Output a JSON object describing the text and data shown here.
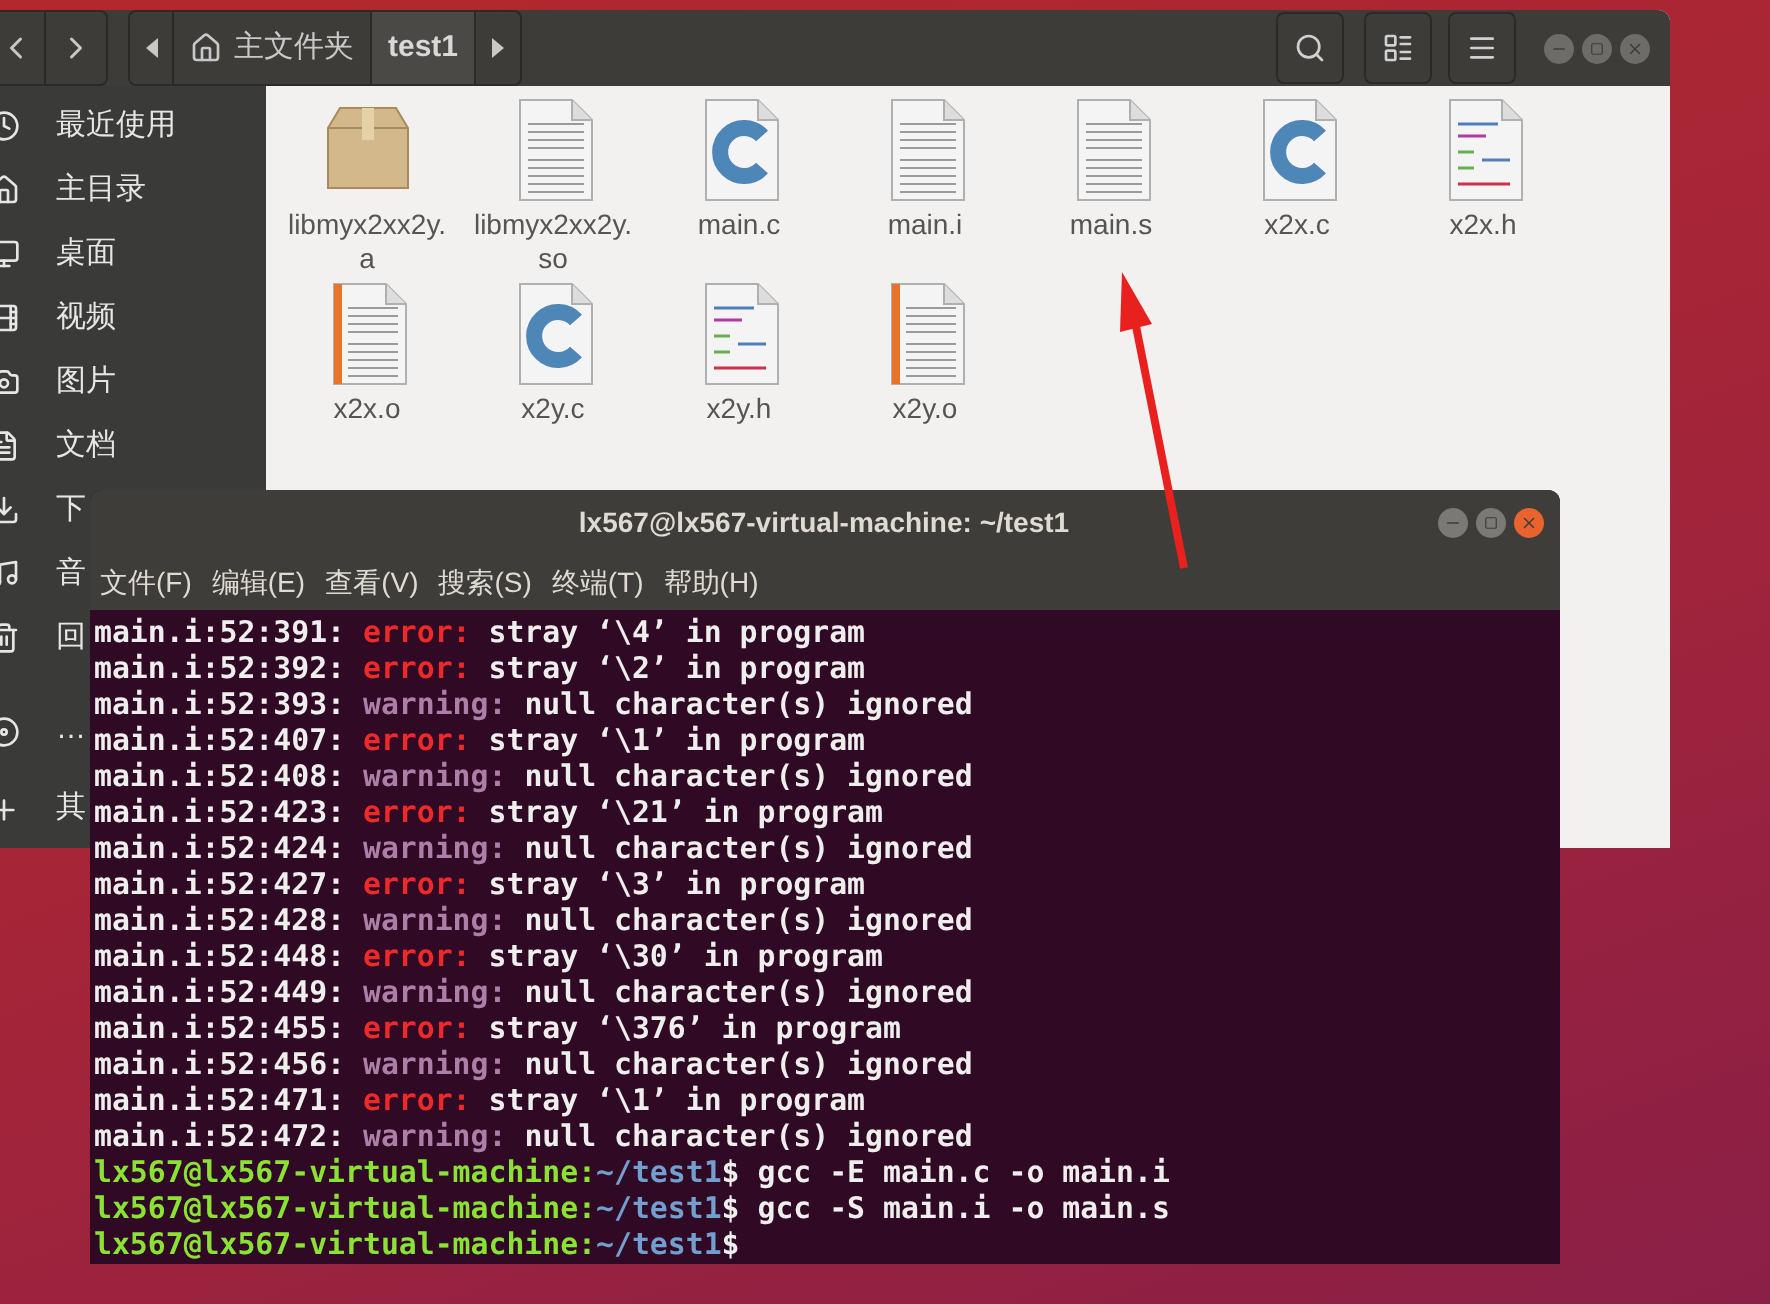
{
  "file_manager": {
    "path_bar": [
      {
        "label": "主文件夹",
        "kind": "home",
        "selected": false
      },
      {
        "label": "test1",
        "kind": "folder",
        "selected": true
      }
    ],
    "sidebar": {
      "sections": [
        [
          {
            "label": "最近使用",
            "kind": "recent"
          },
          {
            "label": "主目录",
            "kind": "home"
          },
          {
            "label": "桌面",
            "kind": "desktop"
          },
          {
            "label": "视频",
            "kind": "video"
          },
          {
            "label": "图片",
            "kind": "picture"
          },
          {
            "label": "文档",
            "kind": "document"
          },
          {
            "label": "下",
            "kind": "download"
          },
          {
            "label": "音",
            "kind": "music"
          },
          {
            "label": "回",
            "kind": "trash"
          }
        ],
        [
          {
            "label": "…",
            "kind": "disc"
          },
          {
            "label": "其",
            "kind": "other"
          }
        ]
      ]
    },
    "files": [
      {
        "name": "libmyx2xx2y.a",
        "kind": "archive"
      },
      {
        "name": "libmyx2xx2y.so",
        "kind": "text"
      },
      {
        "name": "main.c",
        "kind": "c"
      },
      {
        "name": "main.i",
        "kind": "text"
      },
      {
        "name": "main.s",
        "kind": "text"
      },
      {
        "name": "x2x.c",
        "kind": "c"
      },
      {
        "name": "x2x.h",
        "kind": "header"
      },
      {
        "name": "x2x.o",
        "kind": "object"
      },
      {
        "name": "x2y.c",
        "kind": "c"
      },
      {
        "name": "x2y.h",
        "kind": "header"
      },
      {
        "name": "x2y.o",
        "kind": "object"
      }
    ]
  },
  "terminal": {
    "title": "lx567@lx567-virtual-machine: ~/test1",
    "menu": [
      "文件(F)",
      "编辑(E)",
      "查看(V)",
      "搜索(S)",
      "终端(T)",
      "帮助(H)"
    ],
    "lines": [
      {
        "kind": "error",
        "location": "main.i:52:391:",
        "label": "error:",
        "message": "stray ‘\\4’ in program"
      },
      {
        "kind": "error",
        "location": "main.i:52:392:",
        "label": "error:",
        "message": "stray ‘\\2’ in program"
      },
      {
        "kind": "warning",
        "location": "main.i:52:393:",
        "label": "warning:",
        "message": "null character(s) ignored"
      },
      {
        "kind": "error",
        "location": "main.i:52:407:",
        "label": "error:",
        "message": "stray ‘\\1’ in program"
      },
      {
        "kind": "warning",
        "location": "main.i:52:408:",
        "label": "warning:",
        "message": "null character(s) ignored"
      },
      {
        "kind": "error",
        "location": "main.i:52:423:",
        "label": "error:",
        "message": "stray ‘\\21’ in program"
      },
      {
        "kind": "warning",
        "location": "main.i:52:424:",
        "label": "warning:",
        "message": "null character(s) ignored"
      },
      {
        "kind": "error",
        "location": "main.i:52:427:",
        "label": "error:",
        "message": "stray ‘\\3’ in program"
      },
      {
        "kind": "warning",
        "location": "main.i:52:428:",
        "label": "warning:",
        "message": "null character(s) ignored"
      },
      {
        "kind": "error",
        "location": "main.i:52:448:",
        "label": "error:",
        "message": "stray ‘\\30’ in program"
      },
      {
        "kind": "warning",
        "location": "main.i:52:449:",
        "label": "warning:",
        "message": "null character(s) ignored"
      },
      {
        "kind": "error",
        "location": "main.i:52:455:",
        "label": "error:",
        "message": "stray ‘\\376’ in program"
      },
      {
        "kind": "warning",
        "location": "main.i:52:456:",
        "label": "warning:",
        "message": "null character(s) ignored"
      },
      {
        "kind": "error",
        "location": "main.i:52:471:",
        "label": "error:",
        "message": "stray ‘\\1’ in program"
      },
      {
        "kind": "warning",
        "location": "main.i:52:472:",
        "label": "warning:",
        "message": "null character(s) ignored"
      },
      {
        "kind": "prompt",
        "user": "lx567@lx567-virtual-machine:",
        "path": "~/test1",
        "command": "$ gcc -E main.c -o main.i"
      },
      {
        "kind": "prompt",
        "user": "lx567@lx567-virtual-machine:",
        "path": "~/test1",
        "command": "$ gcc -S main.i -o main.s"
      },
      {
        "kind": "prompt",
        "user": "lx567@lx567-virtual-machine:",
        "path": "~/test1",
        "command": "$"
      }
    ]
  }
}
